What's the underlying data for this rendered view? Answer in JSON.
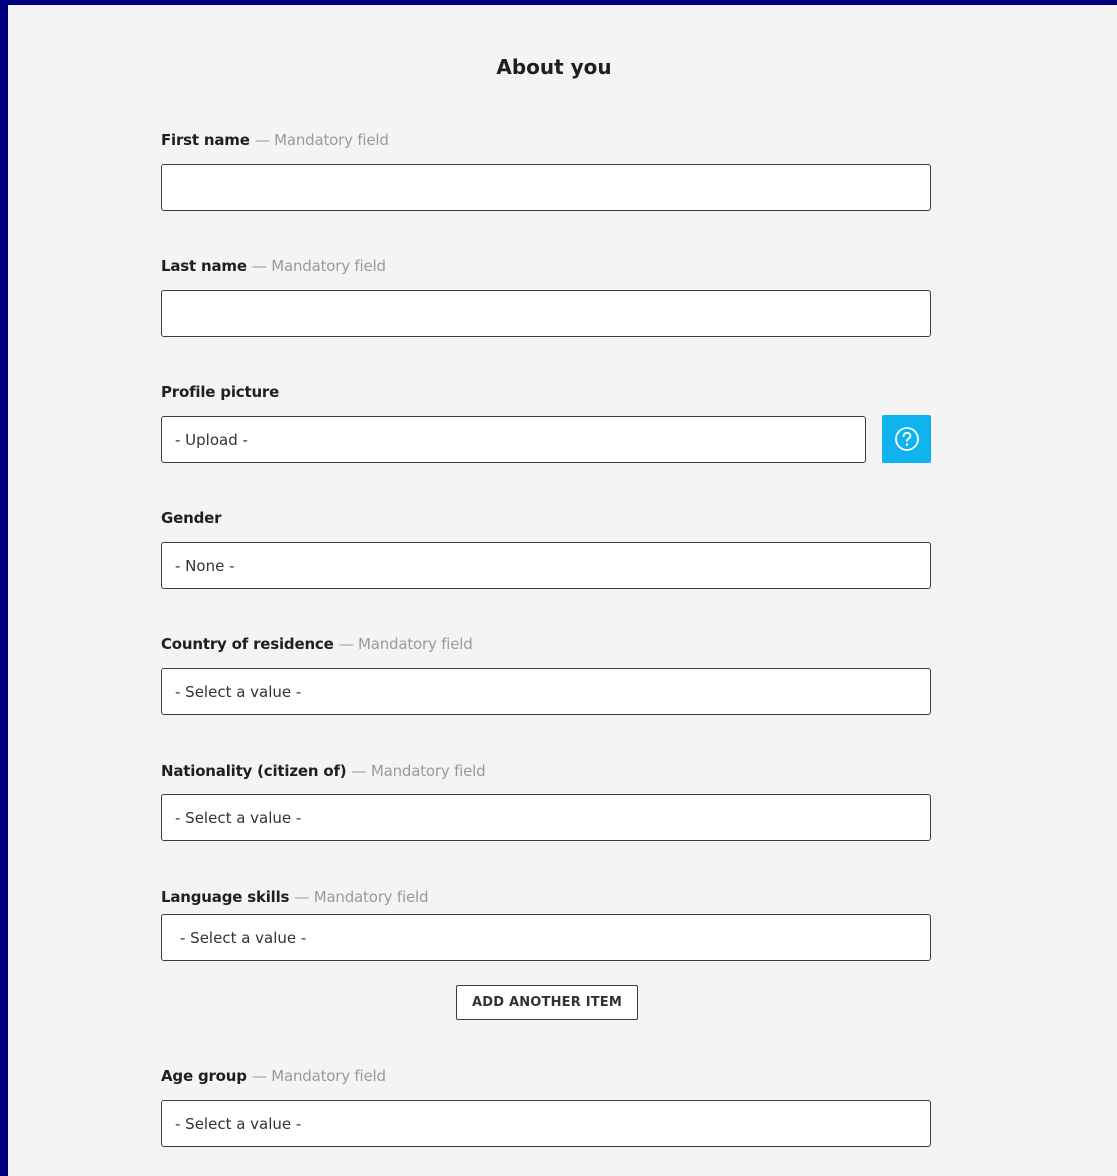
{
  "form": {
    "title": "About you",
    "mandatory_text": "— Mandatory field",
    "fields": {
      "first_name": {
        "label": "First name",
        "value": ""
      },
      "last_name": {
        "label": "Last name",
        "value": ""
      },
      "profile_picture": {
        "label": "Profile picture",
        "value": "- Upload -"
      },
      "gender": {
        "label": "Gender",
        "value": "- None -"
      },
      "country": {
        "label": "Country of residence",
        "value": "- Select a value -"
      },
      "nationality": {
        "label": "Nationality (citizen of)",
        "value": "- Select a value -"
      },
      "language": {
        "label": "Language skills",
        "value": "- Select a value -"
      },
      "age_group": {
        "label": "Age group",
        "value": "- Select a value -"
      }
    },
    "add_item_label": "ADD ANOTHER ITEM"
  },
  "icons": {
    "help": "question-circle-icon"
  },
  "colors": {
    "frame_border": "#00007e",
    "help_button": "#0fb4ef",
    "page_background": "#f4f4f4",
    "mandatory_text": "#9a9a9a"
  }
}
